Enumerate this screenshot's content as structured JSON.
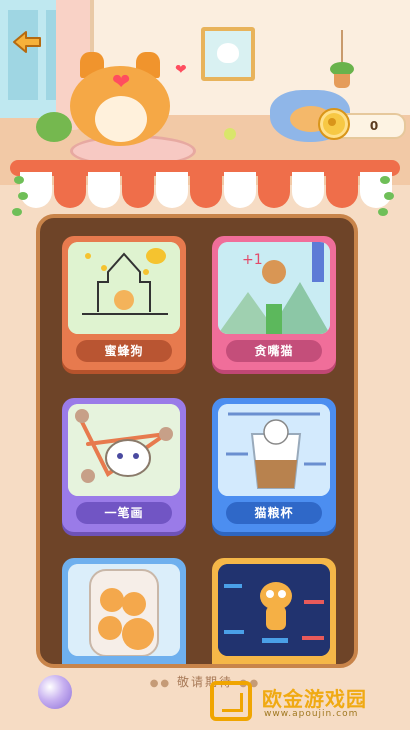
{
  "header": {
    "back_icon": "back-arrow-icon",
    "coins": "0",
    "coin_icon": "coin-icon"
  },
  "games": [
    {
      "label": "蜜蜂狗",
      "theme": "#e77a4e"
    },
    {
      "label": "贪嘴猫",
      "theme": "#f06e9a"
    },
    {
      "label": "一笔画",
      "theme": "#9a7be8"
    },
    {
      "label": "猫粮杯",
      "theme": "#4c8ef0"
    },
    {
      "label": "",
      "theme": "#6fb0ee"
    },
    {
      "label": "",
      "theme": "#f5b748"
    }
  ],
  "footer": {
    "coming_soon": "敬请期待"
  },
  "watermark": {
    "name": "欧金游戏园",
    "url": "www.apoujin.com"
  }
}
